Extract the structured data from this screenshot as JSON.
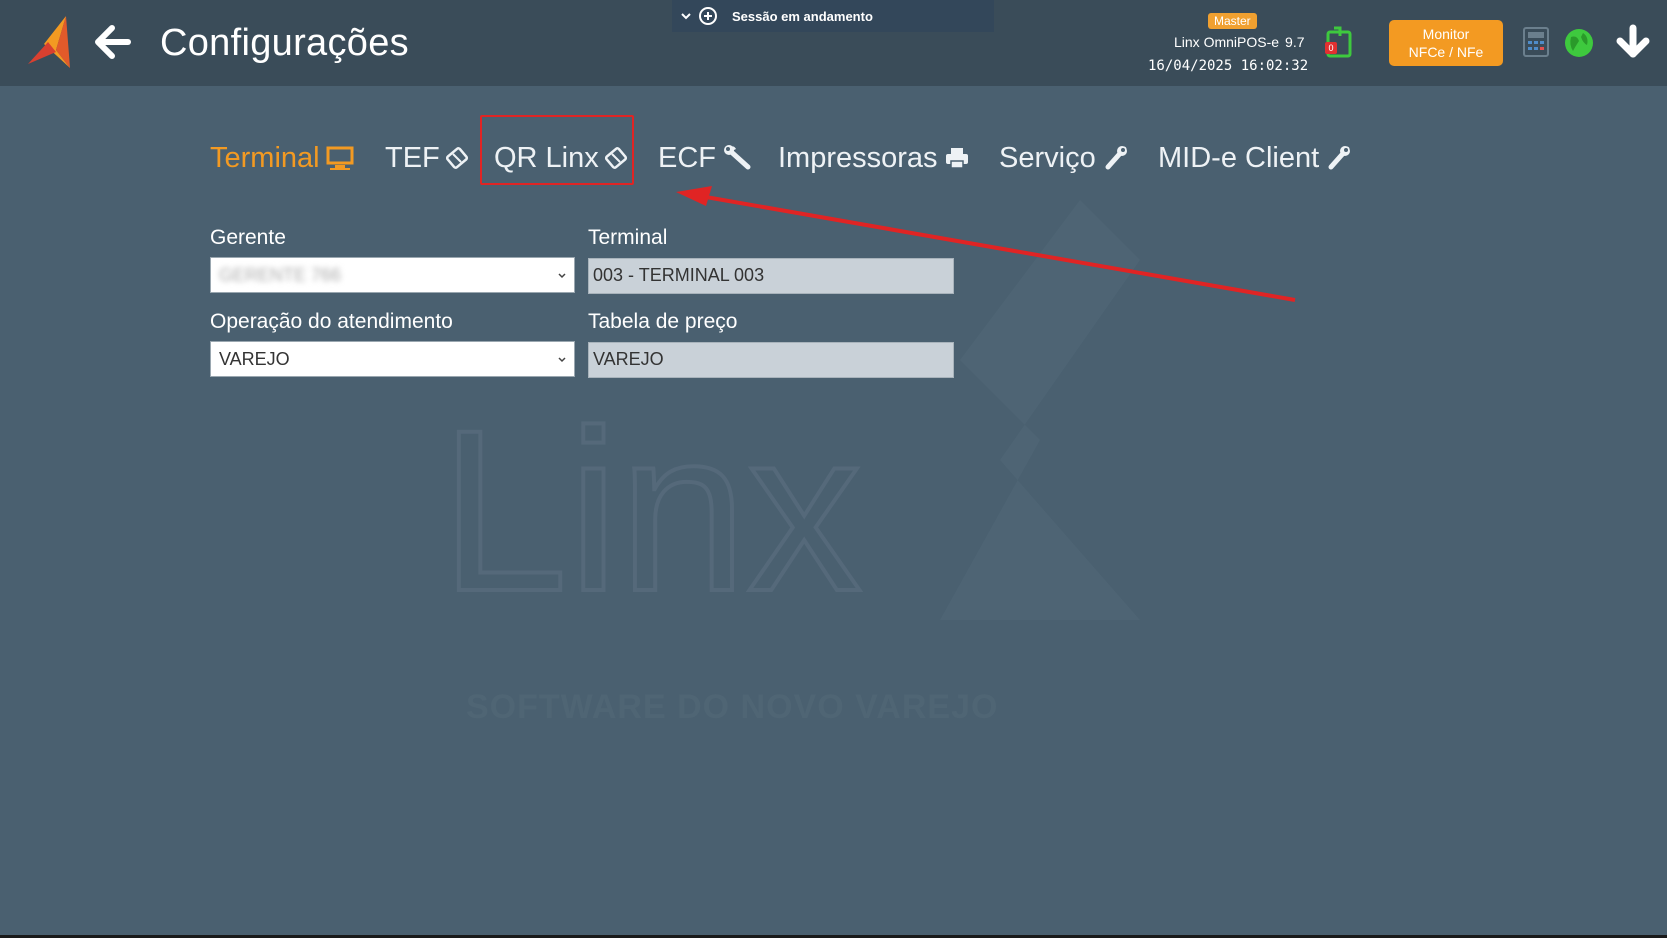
{
  "header": {
    "title": "Configurações",
    "session_label": "Sessão em andamento",
    "badge": "Master",
    "app_name": "Linx OmniPOS-e",
    "app_version": "9.7",
    "datetime": "16/04/2025 16:02:32",
    "notification_count": "0",
    "monitor_button_line1": "Monitor",
    "monitor_button_line2": "NFCe / NFe"
  },
  "tabs": [
    {
      "label": "Terminal",
      "icon": "monitor-icon",
      "active": true
    },
    {
      "label": "TEF",
      "icon": "card-icon"
    },
    {
      "label": "QR Linx",
      "icon": "card-icon"
    },
    {
      "label": "ECF",
      "icon": "wrench-icon"
    },
    {
      "label": "Impressoras",
      "icon": "printer-icon"
    },
    {
      "label": "Serviço",
      "icon": "wrench-icon"
    },
    {
      "label": "MID-e Client",
      "icon": "wrench-icon"
    }
  ],
  "form": {
    "gerente_label": "Gerente",
    "gerente_value": "GERENTE 766",
    "terminal_label": "Terminal",
    "terminal_value": "003 - TERMINAL 003",
    "operacao_label": "Operação do atendimento",
    "operacao_value": "VAREJO",
    "tabela_label": "Tabela de preço",
    "tabela_value": "VAREJO"
  },
  "watermark": {
    "text": "Linx",
    "tagline": "SOFTWARE DO NOVO VAREJO"
  },
  "colors": {
    "background": "#4a6070",
    "topbar": "#3a4c59",
    "accent": "#f39a22",
    "highlight": "#e02424"
  }
}
